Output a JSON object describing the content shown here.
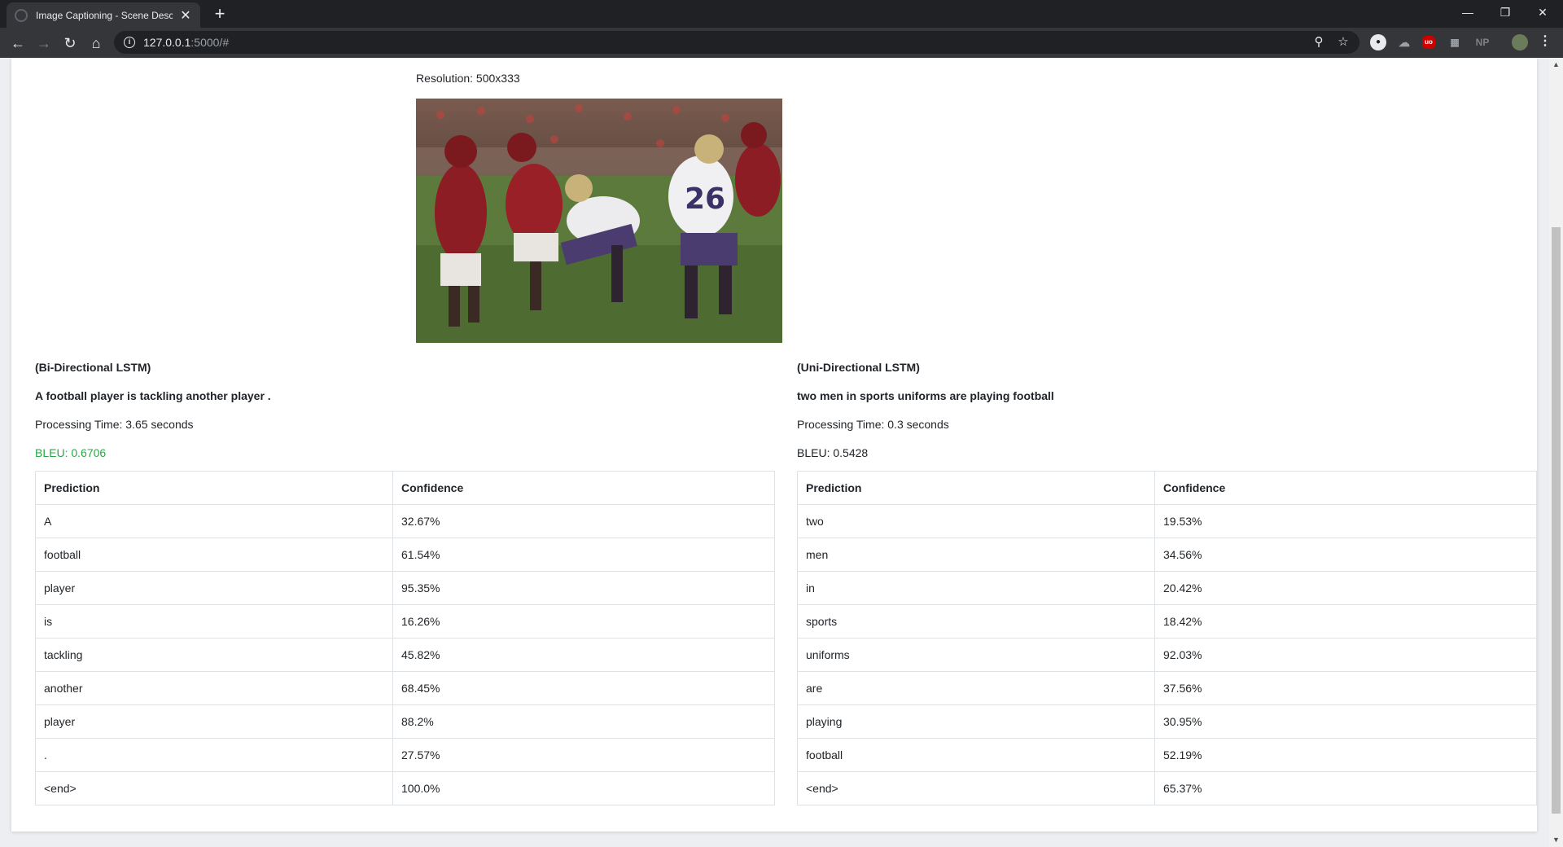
{
  "browser": {
    "tab_title": "Image Captioning - Scene Description",
    "tab_close": "✕",
    "new_tab": "+",
    "url_host": "127.0.0.1",
    "url_rest": ":5000/#",
    "ext_np": "NP",
    "ext_ub": "uo"
  },
  "page": {
    "resolution": "Resolution: 500x333"
  },
  "left": {
    "model": "(Bi-Directional LSTM)",
    "caption": "A football player is tackling another player .",
    "time": "Processing Time: 3.65 seconds",
    "bleu": "BLEU: 0.6706",
    "header_pred": "Prediction",
    "header_conf": "Confidence",
    "rows": [
      {
        "word": "A",
        "conf": "32.67%"
      },
      {
        "word": "football",
        "conf": "61.54%"
      },
      {
        "word": "player",
        "conf": "95.35%"
      },
      {
        "word": "is",
        "conf": "16.26%"
      },
      {
        "word": "tackling",
        "conf": "45.82%"
      },
      {
        "word": "another",
        "conf": "68.45%"
      },
      {
        "word": "player",
        "conf": "88.2%"
      },
      {
        "word": ".",
        "conf": "27.57%"
      },
      {
        "word": "<end>",
        "conf": "100.0%"
      }
    ]
  },
  "right": {
    "model": "(Uni-Directional LSTM)",
    "caption": "two men in sports uniforms are playing football",
    "time": "Processing Time: 0.3 seconds",
    "bleu": "BLEU: 0.5428",
    "header_pred": "Prediction",
    "header_conf": "Confidence",
    "rows": [
      {
        "word": "two",
        "conf": "19.53%"
      },
      {
        "word": "men",
        "conf": "34.56%"
      },
      {
        "word": "in",
        "conf": "20.42%"
      },
      {
        "word": "sports",
        "conf": "18.42%"
      },
      {
        "word": "uniforms",
        "conf": "92.03%"
      },
      {
        "word": "are",
        "conf": "37.56%"
      },
      {
        "word": "playing",
        "conf": "30.95%"
      },
      {
        "word": "football",
        "conf": "52.19%"
      },
      {
        "word": "<end>",
        "conf": "65.37%"
      }
    ]
  },
  "colors": {
    "bleu_good": "#28a745",
    "chrome_dark": "#202124",
    "chrome_tab": "#35363a"
  }
}
